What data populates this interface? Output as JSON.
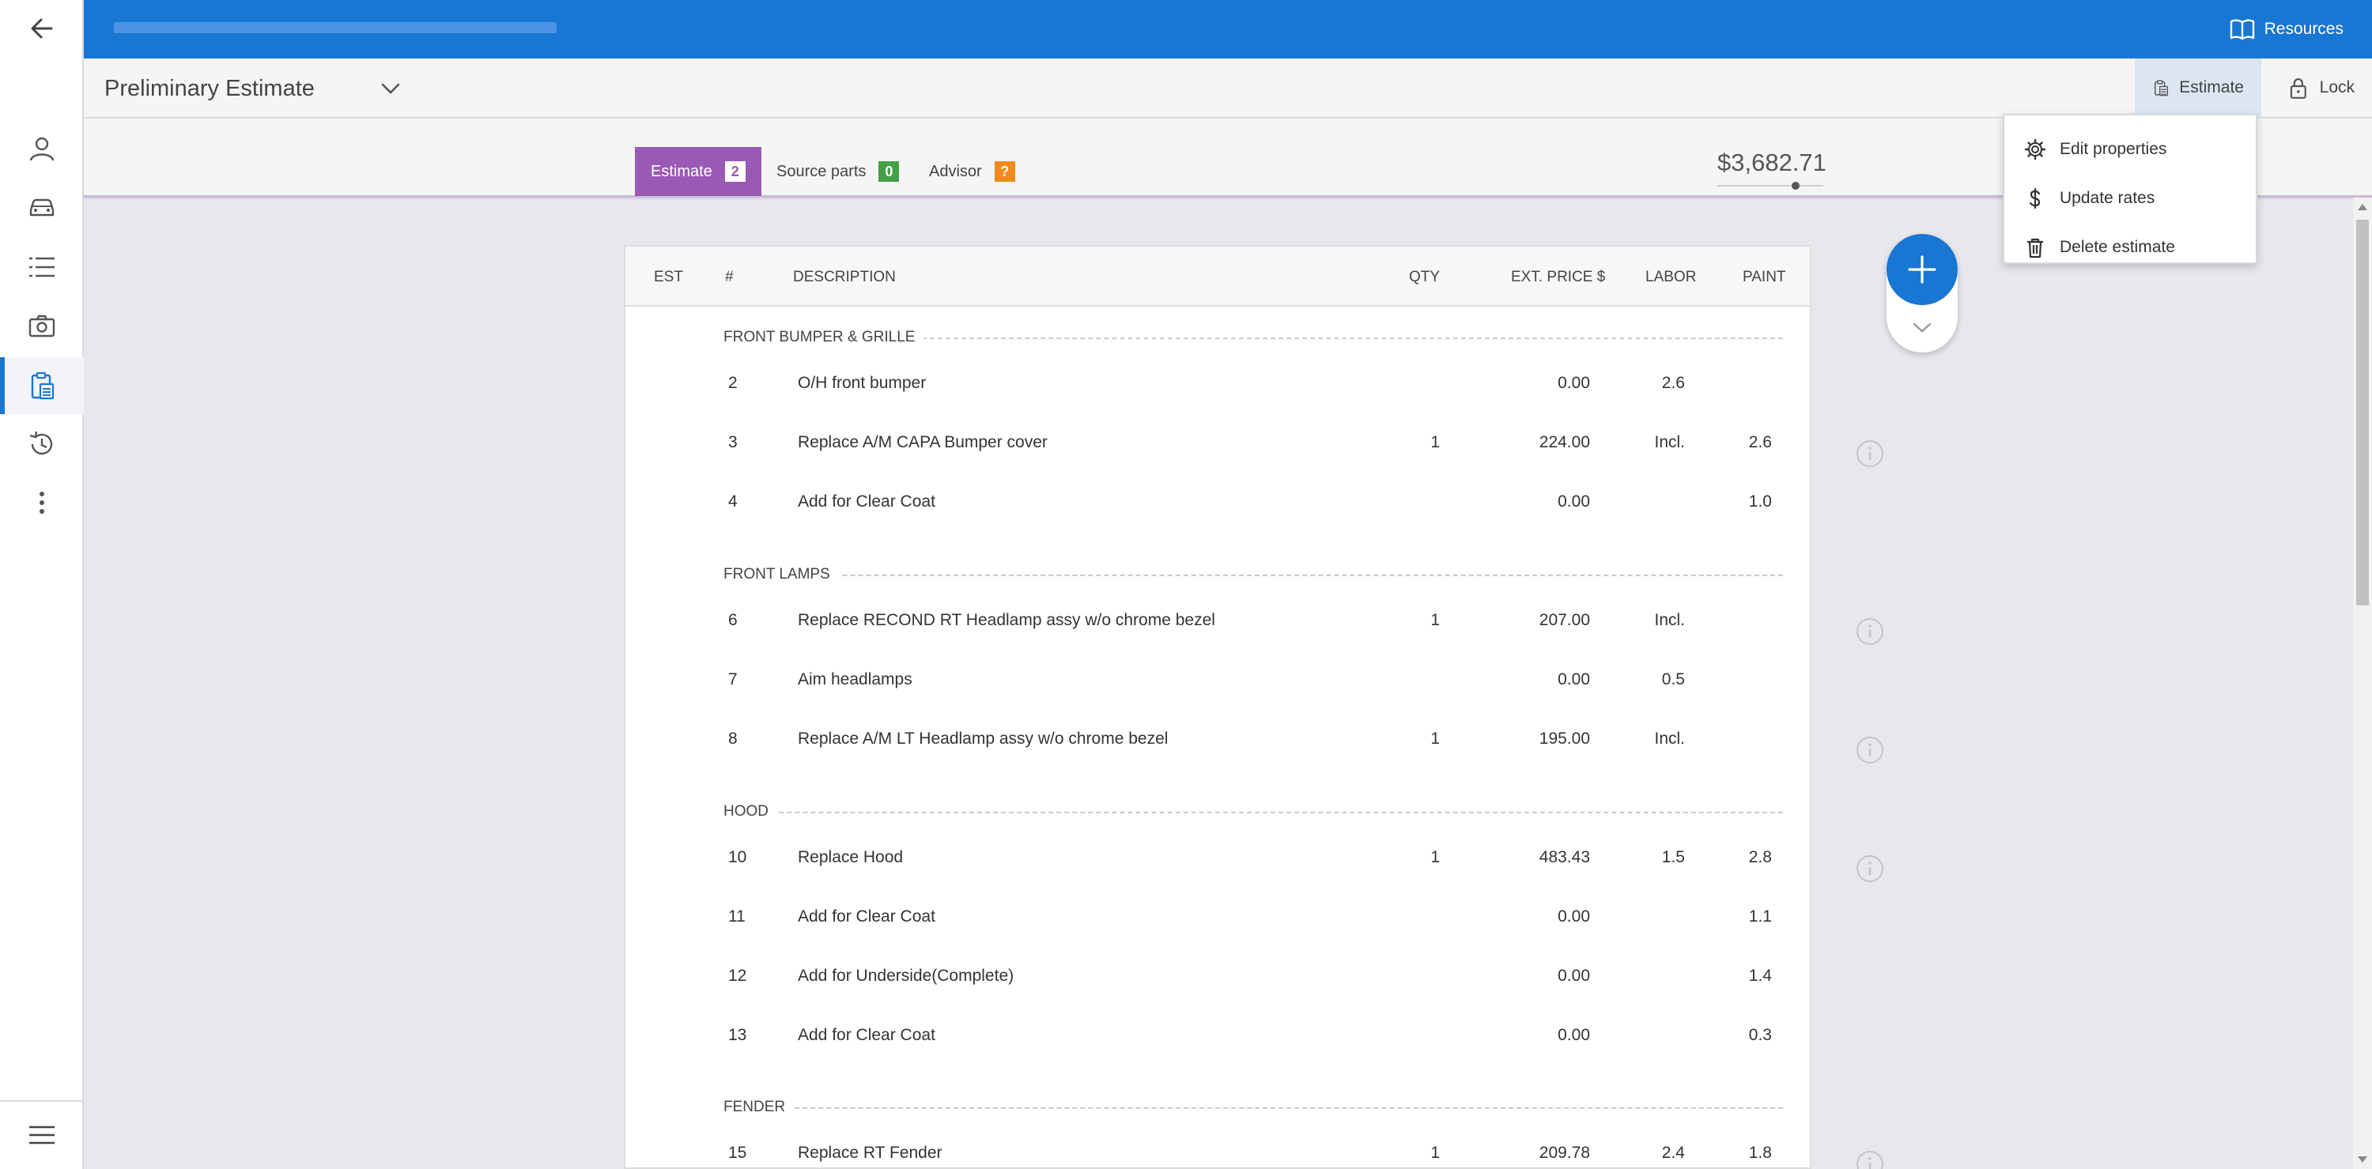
{
  "topbar": {
    "resources_label": "Resources",
    "progress": 0.25
  },
  "header": {
    "title": "Preliminary Estimate",
    "estimate_label": "Estimate",
    "lock_label": "Lock"
  },
  "tabs": [
    {
      "label": "Estimate",
      "badge": "2",
      "badge_color": "#ffffff"
    },
    {
      "label": "Source parts",
      "badge": "0",
      "badge_color": "#43a047"
    },
    {
      "label": "Advisor",
      "badge": "?",
      "badge_color": "#ef8a1c"
    }
  ],
  "total": "$3,682.71",
  "menu": [
    {
      "label": "Edit properties",
      "icon": "gear-icon"
    },
    {
      "label": "Update rates",
      "icon": "dollar-icon"
    },
    {
      "label": "Delete estimate",
      "icon": "trash-icon"
    }
  ],
  "table": {
    "headers": {
      "est": "EST",
      "num": "#",
      "desc": "DESCRIPTION",
      "qty": "QTY",
      "price": "EXT. PRICE $",
      "labor": "LABOR",
      "paint": "PAINT"
    },
    "sections": [
      {
        "name": "FRONT BUMPER & GRILLE",
        "rows": [
          {
            "num": "2",
            "desc": "O/H front bumper",
            "qty": "",
            "price": "0.00",
            "labor": "2.6",
            "paint": "",
            "info": false
          },
          {
            "num": "3",
            "desc": "Replace A/M CAPA Bumper cover",
            "qty": "1",
            "price": "224.00",
            "labor": "Incl.",
            "paint": "2.6",
            "info": true
          },
          {
            "num": "4",
            "desc": "Add for Clear Coat",
            "qty": "",
            "price": "0.00",
            "labor": "",
            "paint": "1.0",
            "info": false
          }
        ]
      },
      {
        "name": "FRONT LAMPS",
        "rows": [
          {
            "num": "6",
            "desc": "Replace RECOND RT Headlamp assy w/o chrome bezel",
            "qty": "1",
            "price": "207.00",
            "labor": "Incl.",
            "paint": "",
            "info": true
          },
          {
            "num": "7",
            "desc": "Aim headlamps",
            "qty": "",
            "price": "0.00",
            "labor": "0.5",
            "paint": "",
            "info": false
          },
          {
            "num": "8",
            "desc": "Replace A/M LT Headlamp assy w/o chrome bezel",
            "qty": "1",
            "price": "195.00",
            "labor": "Incl.",
            "paint": "",
            "info": true
          }
        ]
      },
      {
        "name": "HOOD",
        "rows": [
          {
            "num": "10",
            "desc": "Replace Hood",
            "qty": "1",
            "price": "483.43",
            "labor": "1.5",
            "paint": "2.8",
            "info": true
          },
          {
            "num": "11",
            "desc": "Add for Clear Coat",
            "qty": "",
            "price": "0.00",
            "labor": "",
            "paint": "1.1",
            "info": false
          },
          {
            "num": "12",
            "desc": "Add for Underside(Complete)",
            "qty": "",
            "price": "0.00",
            "labor": "",
            "paint": "1.4",
            "info": false
          },
          {
            "num": "13",
            "desc": "Add for Clear Coat",
            "qty": "",
            "price": "0.00",
            "labor": "",
            "paint": "0.3",
            "info": false
          }
        ]
      },
      {
        "name": "FENDER",
        "rows": [
          {
            "num": "15",
            "desc": "Replace RT Fender",
            "qty": "1",
            "price": "209.78",
            "labor": "2.4",
            "paint": "1.8",
            "info": true
          }
        ]
      }
    ]
  },
  "colors": {
    "primary": "#1976d2",
    "estimate_tab": "#9b59b6"
  }
}
